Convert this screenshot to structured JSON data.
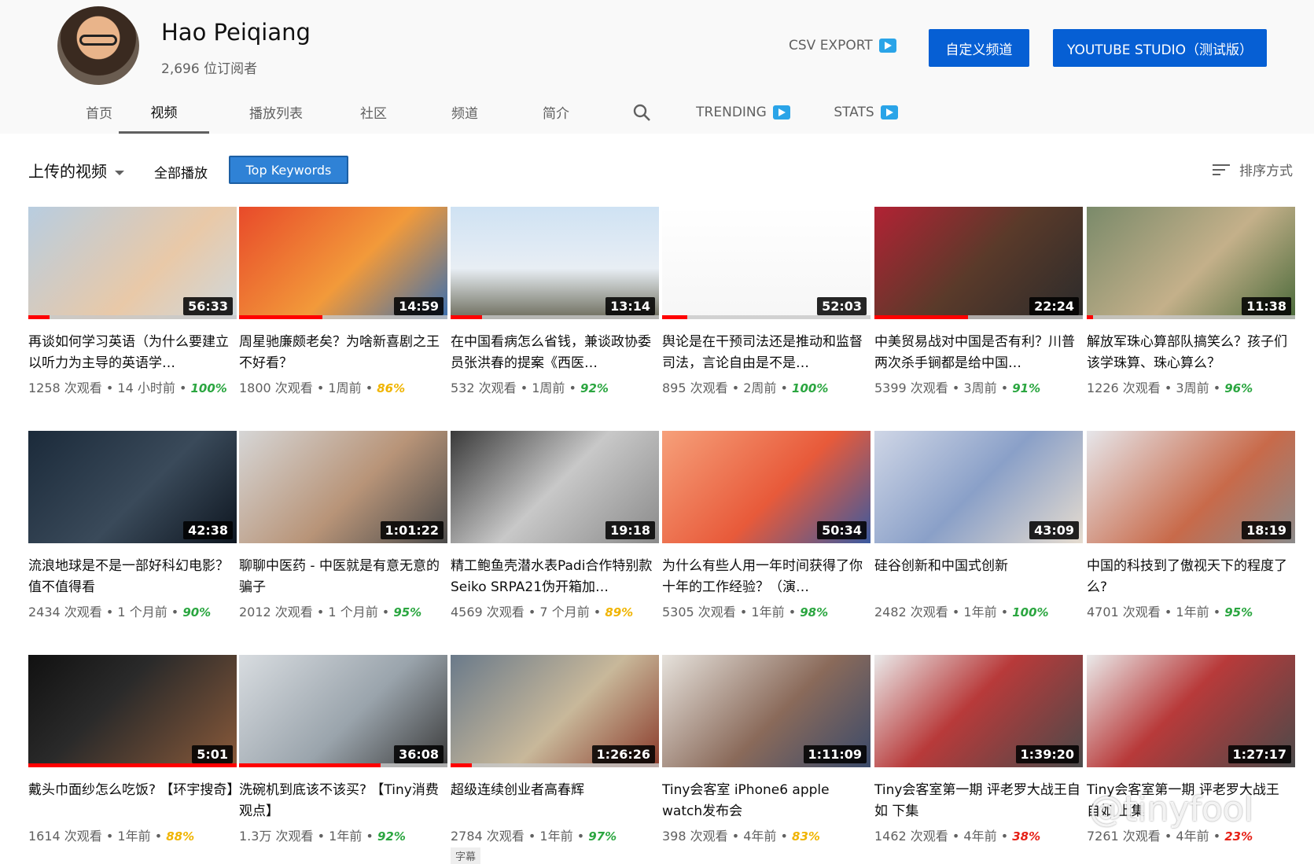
{
  "channel": {
    "name": "Hao Peiqiang",
    "subscribers": "2,696 位订阅者"
  },
  "header_actions": {
    "csv_export": "CSV EXPORT",
    "customize": "自定义频道",
    "studio": "YOUTUBE STUDIO（测试版）"
  },
  "tabs": [
    "首页",
    "视频",
    "播放列表",
    "社区",
    "频道",
    "简介"
  ],
  "extra_tabs": {
    "trending": "TRENDING",
    "stats": "STATS"
  },
  "subbar": {
    "uploads": "上传的视频",
    "play_all": "全部播放",
    "top_keywords": "Top Keywords",
    "sort": "排序方式"
  },
  "colors": {
    "accent_blue": "#065fd4",
    "progress_red": "#ff0000",
    "pct_green": "#2ba640",
    "pct_yellow": "#f0b400",
    "pct_red": "#e62117"
  },
  "videos": [
    {
      "duration": "56:33",
      "title": "再谈如何学习英语（为什么要建立以听力为主导的英语学…",
      "views": "1258 次观看",
      "age": "14 小时前",
      "score": "100%",
      "score_color": "green",
      "watched": 0.1
    },
    {
      "duration": "14:59",
      "title": "周星驰廉颇老矣？为啥新喜剧之王不好看？",
      "views": "1800 次观看",
      "age": "1周前",
      "score": "86%",
      "score_color": "yellow",
      "watched": 0.4
    },
    {
      "duration": "13:14",
      "title": "在中国看病怎么省钱，兼谈政协委员张洪春的提案《西医…",
      "views": "532 次观看",
      "age": "1周前",
      "score": "92%",
      "score_color": "green",
      "watched": 0.15
    },
    {
      "duration": "52:03",
      "title": "舆论是在干预司法还是推动和监督司法，言论自由是不是…",
      "views": "895 次观看",
      "age": "2周前",
      "score": "100%",
      "score_color": "green",
      "watched": 0.12
    },
    {
      "duration": "22:24",
      "title": "中美贸易战对中国是否有利？川普两次杀手锏都是给中国…",
      "views": "5399 次观看",
      "age": "3周前",
      "score": "91%",
      "score_color": "green",
      "watched": 0.45
    },
    {
      "duration": "11:38",
      "title": "解放军珠心算部队搞笑么？孩子们该学珠算、珠心算么？",
      "views": "1226 次观看",
      "age": "3周前",
      "score": "96%",
      "score_color": "green",
      "watched": 0.03
    },
    {
      "duration": "42:38",
      "title": "流浪地球是不是一部好科幻电影？值不值得看",
      "views": "2434 次观看",
      "age": "1 个月前",
      "score": "90%",
      "score_color": "green",
      "watched": 0
    },
    {
      "duration": "1:01:22",
      "title": "聊聊中医药 - 中医就是有意无意的骗子",
      "views": "2012 次观看",
      "age": "1 个月前",
      "score": "95%",
      "score_color": "green",
      "watched": 0
    },
    {
      "duration": "19:18",
      "title": "精工鲍鱼壳潜水表Padi合作特别款Seiko SRPA21伪开箱加…",
      "views": "4569 次观看",
      "age": "7 个月前",
      "score": "89%",
      "score_color": "yellow",
      "watched": 0
    },
    {
      "duration": "50:34",
      "title": "为什么有些人用一年时间获得了你十年的工作经验？（演…",
      "views": "5305 次观看",
      "age": "1年前",
      "score": "98%",
      "score_color": "green",
      "watched": 0
    },
    {
      "duration": "43:09",
      "title": "硅谷创新和中国式创新",
      "views": "2482 次观看",
      "age": "1年前",
      "score": "100%",
      "score_color": "green",
      "watched": 0
    },
    {
      "duration": "18:19",
      "title": "中国的科技到了傲视天下的程度了么?",
      "views": "4701 次观看",
      "age": "1年前",
      "score": "95%",
      "score_color": "green",
      "watched": 0
    },
    {
      "duration": "5:01",
      "title": "戴头巾面纱怎么吃饭? 【环宇搜奇】",
      "views": "1614 次观看",
      "age": "1年前",
      "score": "88%",
      "score_color": "yellow",
      "watched": 1.0
    },
    {
      "duration": "36:08",
      "title": "洗碗机到底该不该买? 【Tiny消费观点】",
      "views": "1.3万 次观看",
      "age": "1年前",
      "score": "92%",
      "score_color": "green",
      "watched": 0.68
    },
    {
      "duration": "1:26:26",
      "title": "超级连续创业者高春辉",
      "views": "2784 次观看",
      "age": "1年前",
      "score": "97%",
      "score_color": "green",
      "watched": 0.1,
      "badge": "字幕"
    },
    {
      "duration": "1:11:09",
      "title": "Tiny会客室 iPhone6 apple watch发布会",
      "views": "398 次观看",
      "age": "4年前",
      "score": "83%",
      "score_color": "yellow",
      "watched": 0
    },
    {
      "duration": "1:39:20",
      "title": "Tiny会客室第一期 评老罗大战王自如 下集",
      "views": "1462 次观看",
      "age": "4年前",
      "score": "38%",
      "score_color": "red",
      "watched": 0
    },
    {
      "duration": "1:27:17",
      "title": "Tiny会客室第一期 评老罗大战王自如 上集",
      "views": "7261 次观看",
      "age": "4年前",
      "score": "23%",
      "score_color": "red",
      "watched": 0
    }
  ],
  "watermark": "@tinyfool"
}
